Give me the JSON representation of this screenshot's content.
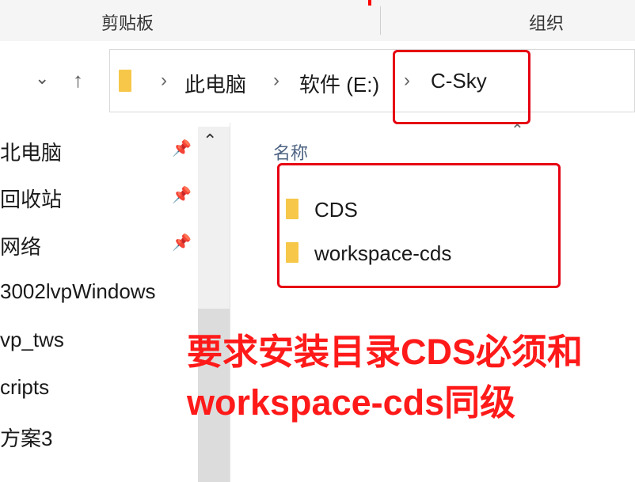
{
  "ribbon": {
    "clipboard_label": "剪贴板",
    "organize_label": "组织"
  },
  "navigation": {
    "back_icon": "chevron-down-icon",
    "up_icon": "arrow-up-icon"
  },
  "breadcrumb": {
    "items": [
      {
        "label": "此电脑"
      },
      {
        "label": "软件 (E:)"
      },
      {
        "label": "C-Sky"
      }
    ]
  },
  "nav_pane": {
    "items": [
      {
        "label": "北电脑",
        "pinned": true
      },
      {
        "label": "回收站",
        "pinned": true
      },
      {
        "label": "网络",
        "pinned": true
      },
      {
        "label": "3002lvpWindows",
        "pinned": false
      },
      {
        "label": "vp_tws",
        "pinned": false
      },
      {
        "label": "cripts",
        "pinned": false
      },
      {
        "label": "方案3",
        "pinned": false
      }
    ]
  },
  "file_list": {
    "column_name": "名称",
    "files": [
      {
        "name": "CDS",
        "type": "folder"
      },
      {
        "name": "workspace-cds",
        "type": "folder"
      }
    ]
  },
  "annotation": {
    "line1": "要求安装目录CDS必须和",
    "line2": "workspace-cds同级"
  },
  "colors": {
    "highlight": "#e60012",
    "annotation_text": "#ff1a1a",
    "folder": "#f7c749",
    "column_header": "#4d6382"
  }
}
